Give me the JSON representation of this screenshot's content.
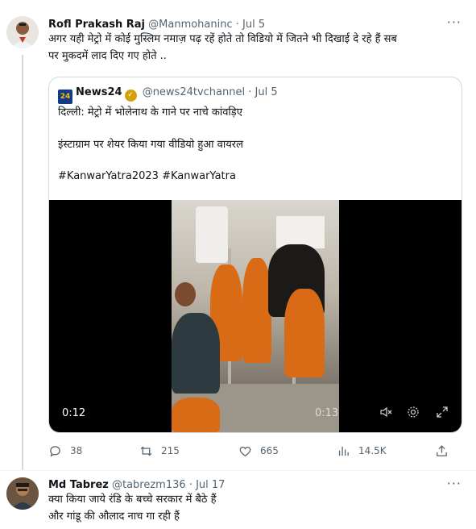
{
  "tweet1": {
    "name": "Rofl Prakash Raj",
    "handle": "@Manmohaninc",
    "separator": "·",
    "time": "Jul 5",
    "text_line1": "अगर यही मेट्रो में कोई मुस्लिम नमाज़ पढ़ रहें होते तो विडियो में जितने भी दिखाई दे रहे हैं सब",
    "text_line2": "पर मुकदमें लाद दिए गए होते ..",
    "more": "···",
    "quote": {
      "logo_text": "24",
      "name": "News24",
      "handle": "@news24tvchannel",
      "separator": "·",
      "time": "Jul 5",
      "line1": "दिल्ली: मेट्रो में भोलेनाथ के गाने पर नाचे कांवड़िए",
      "line2": "इंस्टाग्राम पर शेयर किया गया वीडियो हुआ वायरल",
      "line3": "#KanwarYatra2023 #KanwarYatra",
      "video": {
        "elapsed": "0:12",
        "total": "0:13"
      }
    },
    "actions": {
      "replies": "38",
      "retweets": "215",
      "likes": "665",
      "views": "14.5K"
    }
  },
  "tweet2": {
    "name": "Md Tabrez",
    "handle": "@tabrezm136",
    "separator": "·",
    "time": "Jul 17",
    "text_line1": "क्या किया जाये रंडि के बच्चे  सरकार में बैठे हैं",
    "text_line2": "और गांडू की औलाद नाच गा रही हैं",
    "more": "···"
  },
  "colors": {
    "text_primary": "#0f1419",
    "text_secondary": "#536471",
    "border": "#cfd9de",
    "saffron": "#d96b16"
  }
}
